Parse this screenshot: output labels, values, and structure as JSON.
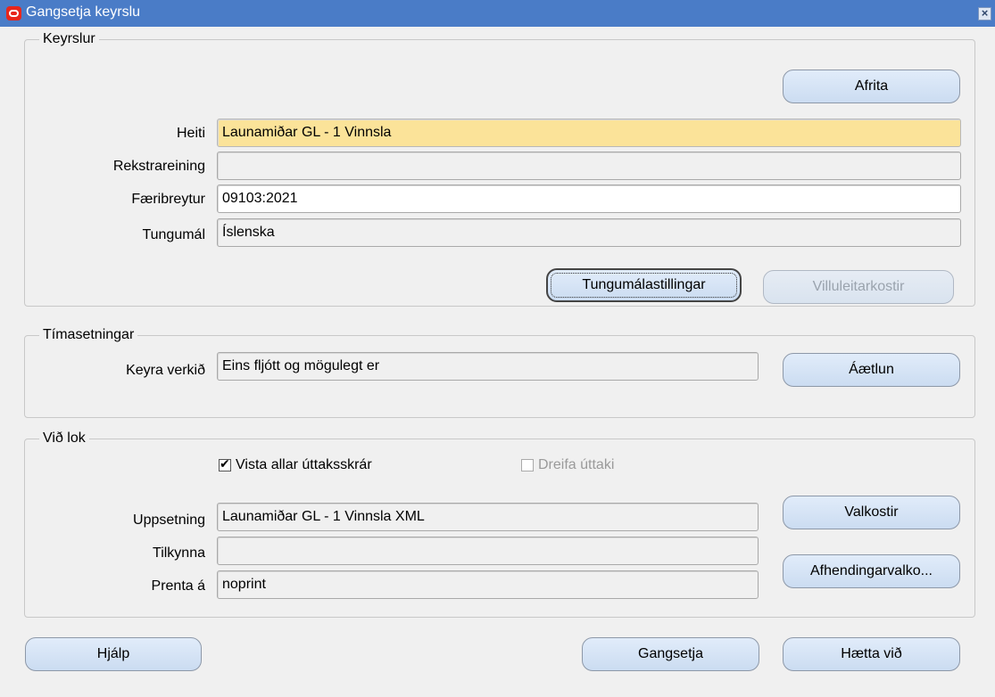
{
  "window": {
    "title": "Gangsetja keyrslu",
    "close_glyph": "×"
  },
  "keyrslur": {
    "group_title": "Keyrslur",
    "copy_button": "Afrita",
    "fields": {
      "heiti": {
        "label": "Heiti",
        "value": "Launamiðar GL - 1 Vinnsla"
      },
      "rekstrareining": {
        "label": "Rekstrareining",
        "value": ""
      },
      "faeribreytur": {
        "label": "Færibreytur",
        "value": "09103:2021"
      },
      "tungumal": {
        "label": "Tungumál",
        "value": "Íslenska"
      }
    },
    "language_settings_button": "Tungumálastillingar",
    "debug_options_button": "Villuleitarkostir"
  },
  "timasetningar": {
    "group_title": "Tímasetningar",
    "run_label": "Keyra verkið",
    "run_value": "Eins fljótt og mögulegt er",
    "schedule_button": "Áætlun"
  },
  "vid_lok": {
    "group_title": "Við lok",
    "save_all_checkbox": {
      "label": "Vista allar úttaksskrár",
      "checked": true
    },
    "distribute_checkbox": {
      "label": "Dreifa úttaki",
      "checked": false,
      "disabled": true
    },
    "fields": {
      "uppsetning": {
        "label": "Uppsetning",
        "value": "Launamiðar GL - 1 Vinnsla XML"
      },
      "tilkynna": {
        "label": "Tilkynna",
        "value": ""
      },
      "prenta": {
        "label": "Prenta á",
        "value": "noprint"
      }
    },
    "options_button": "Valkostir",
    "delivery_button": "Afhendingarvalko..."
  },
  "footer": {
    "help_button": "Hjálp",
    "submit_button": "Gangsetja",
    "cancel_button": "Hætta við"
  }
}
